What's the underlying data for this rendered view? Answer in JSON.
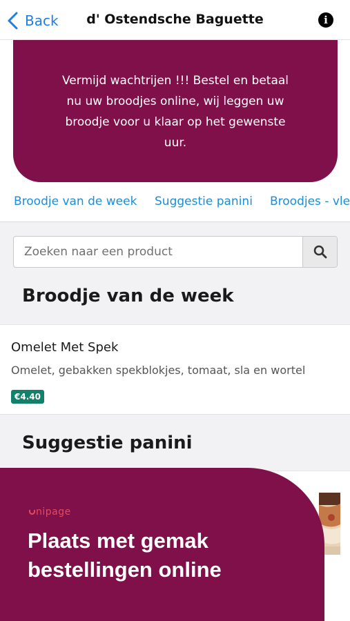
{
  "nav": {
    "back_label": "Back",
    "title": "d' Ostendsche Baguette",
    "info_icon": "info-icon"
  },
  "banner": {
    "text": "Vermijd wachtrijen !!! Bestel en betaal nu uw broodjes online, wij leggen uw broodje voor u klaar op het gewenste uur."
  },
  "tabs": [
    {
      "label": "Broodje van de week"
    },
    {
      "label": "Suggestie panini"
    },
    {
      "label": "Broodjes - vle"
    }
  ],
  "search": {
    "placeholder": "Zoeken naar een product",
    "button_icon": "search-icon"
  },
  "sections": [
    {
      "title": "Broodje van de week",
      "products": [
        {
          "name": "Omelet Met Spek",
          "description": "Omelet, gebakken spekblokjes, tomaat, sla en wortel",
          "price": "€4.40"
        }
      ]
    },
    {
      "title": "Suggestie panini"
    }
  ],
  "promo": {
    "logo": "unipage",
    "heading": "Plaats met gemak bestellingen online"
  },
  "colors": {
    "brand": "#80104a",
    "link": "#1a8ed6",
    "back": "#1f7ee0",
    "price": "#12806a",
    "promo_logo": "#e94a55"
  }
}
